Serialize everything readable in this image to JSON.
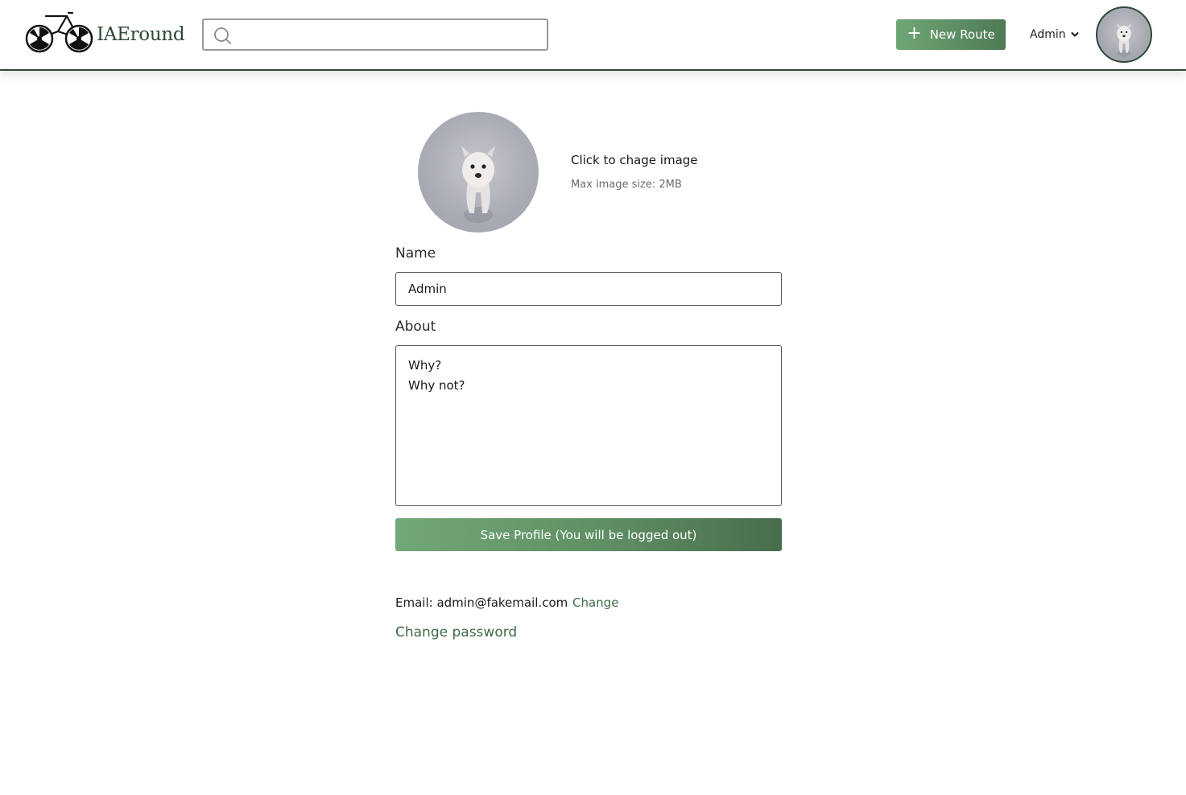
{
  "brand": {
    "name": "IAEround",
    "logo_icon": "bicycle-icon"
  },
  "header": {
    "search": {
      "placeholder": "",
      "value": ""
    },
    "new_route_label": "New Route",
    "user_menu_label": "Admin"
  },
  "profile": {
    "change_image_label": "Click to chage image",
    "max_image_size": "Max image size: 2MB",
    "name_label": "Name",
    "name_value": "Admin",
    "about_label": "About",
    "about_lines": [
      "Why?",
      "Why not?"
    ],
    "save_label": "Save Profile (You will be logged out)",
    "email_text": "Email: admin@fakemail.com",
    "change_email_label": "Change",
    "change_password_label": "Change password"
  },
  "colors": {
    "brand_green": "#2f4a37",
    "button_green_start": "#71a877",
    "button_green_end": "#486d4d",
    "link_green": "#3e6b47"
  }
}
